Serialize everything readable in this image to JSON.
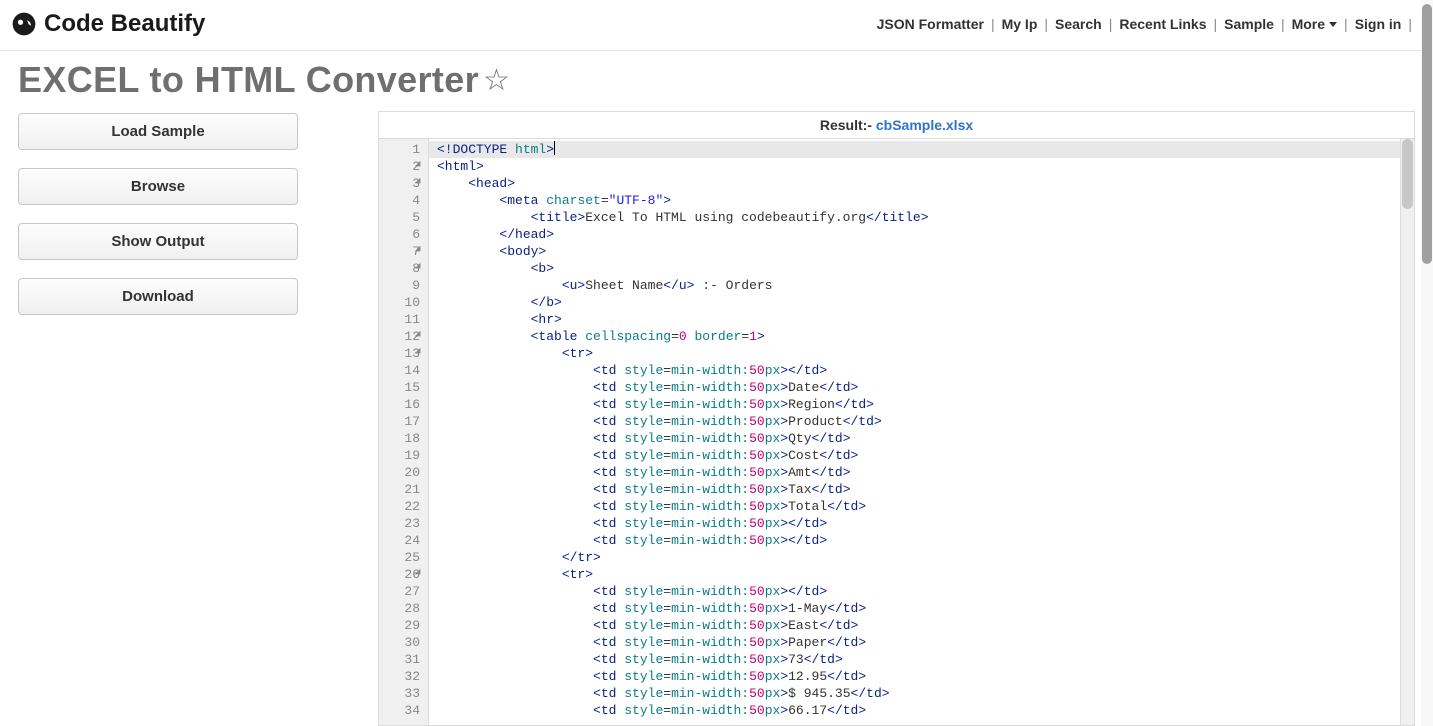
{
  "header": {
    "brand": "Code Beautify",
    "nav": [
      {
        "label": "JSON Formatter",
        "dropdown": false
      },
      {
        "label": "My Ip",
        "dropdown": false
      },
      {
        "label": "Search",
        "dropdown": false
      },
      {
        "label": "Recent Links",
        "dropdown": false
      },
      {
        "label": "Sample",
        "dropdown": false
      },
      {
        "label": "More",
        "dropdown": true
      },
      {
        "label": "Sign in",
        "dropdown": false
      }
    ]
  },
  "page": {
    "title": "EXCEL to HTML Converter"
  },
  "sidebar": {
    "buttons": [
      {
        "label": "Load Sample"
      },
      {
        "label": "Browse"
      },
      {
        "label": "Show Output"
      },
      {
        "label": "Download"
      }
    ]
  },
  "result": {
    "label": "Result:- ",
    "filename": "cbSample.xlsx"
  },
  "editor": {
    "highlighted_line": 1,
    "lines": [
      {
        "n": 1,
        "fold": false,
        "indent": 0,
        "tokens": [
          {
            "t": "tag",
            "v": "<!DOCTYPE "
          },
          {
            "t": "attr",
            "v": "html"
          },
          {
            "t": "tag",
            "v": ">"
          }
        ],
        "cursor": true
      },
      {
        "n": 2,
        "fold": true,
        "indent": 0,
        "tokens": [
          {
            "t": "tag",
            "v": "<html>"
          }
        ]
      },
      {
        "n": 3,
        "fold": true,
        "indent": 1,
        "tokens": [
          {
            "t": "tag",
            "v": "<head>"
          }
        ]
      },
      {
        "n": 4,
        "fold": false,
        "indent": 2,
        "tokens": [
          {
            "t": "tag",
            "v": "<meta "
          },
          {
            "t": "attr",
            "v": "charset"
          },
          {
            "t": "eq",
            "v": "="
          },
          {
            "t": "str",
            "v": "\"UTF-8\""
          },
          {
            "t": "tag",
            "v": ">"
          }
        ]
      },
      {
        "n": 5,
        "fold": false,
        "indent": 3,
        "tokens": [
          {
            "t": "tag",
            "v": "<title>"
          },
          {
            "t": "txt",
            "v": "Excel To HTML using codebeautify.org"
          },
          {
            "t": "tag",
            "v": "</title>"
          }
        ]
      },
      {
        "n": 6,
        "fold": false,
        "indent": 2,
        "tokens": [
          {
            "t": "tag",
            "v": "</head>"
          }
        ]
      },
      {
        "n": 7,
        "fold": true,
        "indent": 2,
        "tokens": [
          {
            "t": "tag",
            "v": "<body>"
          }
        ]
      },
      {
        "n": 8,
        "fold": true,
        "indent": 3,
        "tokens": [
          {
            "t": "tag",
            "v": "<b>"
          }
        ]
      },
      {
        "n": 9,
        "fold": false,
        "indent": 4,
        "tokens": [
          {
            "t": "tag",
            "v": "<u>"
          },
          {
            "t": "txt",
            "v": "Sheet Name"
          },
          {
            "t": "tag",
            "v": "</u>"
          },
          {
            "t": "txt",
            "v": " :- Orders"
          }
        ]
      },
      {
        "n": 10,
        "fold": false,
        "indent": 3,
        "tokens": [
          {
            "t": "tag",
            "v": "</b>"
          }
        ]
      },
      {
        "n": 11,
        "fold": false,
        "indent": 3,
        "tokens": [
          {
            "t": "tag",
            "v": "<hr>"
          }
        ]
      },
      {
        "n": 12,
        "fold": true,
        "indent": 3,
        "tokens": [
          {
            "t": "tag",
            "v": "<table "
          },
          {
            "t": "attr",
            "v": "cellspacing"
          },
          {
            "t": "eq",
            "v": "="
          },
          {
            "t": "num",
            "v": "0"
          },
          {
            "t": "txt",
            "v": " "
          },
          {
            "t": "attr",
            "v": "border"
          },
          {
            "t": "eq",
            "v": "="
          },
          {
            "t": "num",
            "v": "1"
          },
          {
            "t": "tag",
            "v": ">"
          }
        ]
      },
      {
        "n": 13,
        "fold": true,
        "indent": 4,
        "tokens": [
          {
            "t": "tag",
            "v": "<tr>"
          }
        ]
      },
      {
        "n": 14,
        "fold": false,
        "indent": 5,
        "tokens": [
          {
            "t": "tag",
            "v": "<td "
          },
          {
            "t": "attr",
            "v": "style"
          },
          {
            "t": "eq",
            "v": "="
          },
          {
            "t": "attr",
            "v": "min-width:"
          },
          {
            "t": "num",
            "v": "50"
          },
          {
            "t": "attr",
            "v": "px"
          },
          {
            "t": "tag",
            "v": ">"
          },
          {
            "t": "tag",
            "v": "</td>"
          }
        ]
      },
      {
        "n": 15,
        "fold": false,
        "indent": 5,
        "tokens": [
          {
            "t": "tag",
            "v": "<td "
          },
          {
            "t": "attr",
            "v": "style"
          },
          {
            "t": "eq",
            "v": "="
          },
          {
            "t": "attr",
            "v": "min-width:"
          },
          {
            "t": "num",
            "v": "50"
          },
          {
            "t": "attr",
            "v": "px"
          },
          {
            "t": "tag",
            "v": ">"
          },
          {
            "t": "txt",
            "v": "Date"
          },
          {
            "t": "tag",
            "v": "</td>"
          }
        ]
      },
      {
        "n": 16,
        "fold": false,
        "indent": 5,
        "tokens": [
          {
            "t": "tag",
            "v": "<td "
          },
          {
            "t": "attr",
            "v": "style"
          },
          {
            "t": "eq",
            "v": "="
          },
          {
            "t": "attr",
            "v": "min-width:"
          },
          {
            "t": "num",
            "v": "50"
          },
          {
            "t": "attr",
            "v": "px"
          },
          {
            "t": "tag",
            "v": ">"
          },
          {
            "t": "txt",
            "v": "Region"
          },
          {
            "t": "tag",
            "v": "</td>"
          }
        ]
      },
      {
        "n": 17,
        "fold": false,
        "indent": 5,
        "tokens": [
          {
            "t": "tag",
            "v": "<td "
          },
          {
            "t": "attr",
            "v": "style"
          },
          {
            "t": "eq",
            "v": "="
          },
          {
            "t": "attr",
            "v": "min-width:"
          },
          {
            "t": "num",
            "v": "50"
          },
          {
            "t": "attr",
            "v": "px"
          },
          {
            "t": "tag",
            "v": ">"
          },
          {
            "t": "txt",
            "v": "Product"
          },
          {
            "t": "tag",
            "v": "</td>"
          }
        ]
      },
      {
        "n": 18,
        "fold": false,
        "indent": 5,
        "tokens": [
          {
            "t": "tag",
            "v": "<td "
          },
          {
            "t": "attr",
            "v": "style"
          },
          {
            "t": "eq",
            "v": "="
          },
          {
            "t": "attr",
            "v": "min-width:"
          },
          {
            "t": "num",
            "v": "50"
          },
          {
            "t": "attr",
            "v": "px"
          },
          {
            "t": "tag",
            "v": ">"
          },
          {
            "t": "txt",
            "v": "Qty"
          },
          {
            "t": "tag",
            "v": "</td>"
          }
        ]
      },
      {
        "n": 19,
        "fold": false,
        "indent": 5,
        "tokens": [
          {
            "t": "tag",
            "v": "<td "
          },
          {
            "t": "attr",
            "v": "style"
          },
          {
            "t": "eq",
            "v": "="
          },
          {
            "t": "attr",
            "v": "min-width:"
          },
          {
            "t": "num",
            "v": "50"
          },
          {
            "t": "attr",
            "v": "px"
          },
          {
            "t": "tag",
            "v": ">"
          },
          {
            "t": "txt",
            "v": "Cost"
          },
          {
            "t": "tag",
            "v": "</td>"
          }
        ]
      },
      {
        "n": 20,
        "fold": false,
        "indent": 5,
        "tokens": [
          {
            "t": "tag",
            "v": "<td "
          },
          {
            "t": "attr",
            "v": "style"
          },
          {
            "t": "eq",
            "v": "="
          },
          {
            "t": "attr",
            "v": "min-width:"
          },
          {
            "t": "num",
            "v": "50"
          },
          {
            "t": "attr",
            "v": "px"
          },
          {
            "t": "tag",
            "v": ">"
          },
          {
            "t": "txt",
            "v": "Amt"
          },
          {
            "t": "tag",
            "v": "</td>"
          }
        ]
      },
      {
        "n": 21,
        "fold": false,
        "indent": 5,
        "tokens": [
          {
            "t": "tag",
            "v": "<td "
          },
          {
            "t": "attr",
            "v": "style"
          },
          {
            "t": "eq",
            "v": "="
          },
          {
            "t": "attr",
            "v": "min-width:"
          },
          {
            "t": "num",
            "v": "50"
          },
          {
            "t": "attr",
            "v": "px"
          },
          {
            "t": "tag",
            "v": ">"
          },
          {
            "t": "txt",
            "v": "Tax"
          },
          {
            "t": "tag",
            "v": "</td>"
          }
        ]
      },
      {
        "n": 22,
        "fold": false,
        "indent": 5,
        "tokens": [
          {
            "t": "tag",
            "v": "<td "
          },
          {
            "t": "attr",
            "v": "style"
          },
          {
            "t": "eq",
            "v": "="
          },
          {
            "t": "attr",
            "v": "min-width:"
          },
          {
            "t": "num",
            "v": "50"
          },
          {
            "t": "attr",
            "v": "px"
          },
          {
            "t": "tag",
            "v": ">"
          },
          {
            "t": "txt",
            "v": "Total"
          },
          {
            "t": "tag",
            "v": "</td>"
          }
        ]
      },
      {
        "n": 23,
        "fold": false,
        "indent": 5,
        "tokens": [
          {
            "t": "tag",
            "v": "<td "
          },
          {
            "t": "attr",
            "v": "style"
          },
          {
            "t": "eq",
            "v": "="
          },
          {
            "t": "attr",
            "v": "min-width:"
          },
          {
            "t": "num",
            "v": "50"
          },
          {
            "t": "attr",
            "v": "px"
          },
          {
            "t": "tag",
            "v": ">"
          },
          {
            "t": "tag",
            "v": "</td>"
          }
        ]
      },
      {
        "n": 24,
        "fold": false,
        "indent": 5,
        "tokens": [
          {
            "t": "tag",
            "v": "<td "
          },
          {
            "t": "attr",
            "v": "style"
          },
          {
            "t": "eq",
            "v": "="
          },
          {
            "t": "attr",
            "v": "min-width:"
          },
          {
            "t": "num",
            "v": "50"
          },
          {
            "t": "attr",
            "v": "px"
          },
          {
            "t": "tag",
            "v": ">"
          },
          {
            "t": "tag",
            "v": "</td>"
          }
        ]
      },
      {
        "n": 25,
        "fold": false,
        "indent": 4,
        "tokens": [
          {
            "t": "tag",
            "v": "</tr>"
          }
        ]
      },
      {
        "n": 26,
        "fold": true,
        "indent": 4,
        "tokens": [
          {
            "t": "tag",
            "v": "<tr>"
          }
        ]
      },
      {
        "n": 27,
        "fold": false,
        "indent": 5,
        "tokens": [
          {
            "t": "tag",
            "v": "<td "
          },
          {
            "t": "attr",
            "v": "style"
          },
          {
            "t": "eq",
            "v": "="
          },
          {
            "t": "attr",
            "v": "min-width:"
          },
          {
            "t": "num",
            "v": "50"
          },
          {
            "t": "attr",
            "v": "px"
          },
          {
            "t": "tag",
            "v": ">"
          },
          {
            "t": "tag",
            "v": "</td>"
          }
        ]
      },
      {
        "n": 28,
        "fold": false,
        "indent": 5,
        "tokens": [
          {
            "t": "tag",
            "v": "<td "
          },
          {
            "t": "attr",
            "v": "style"
          },
          {
            "t": "eq",
            "v": "="
          },
          {
            "t": "attr",
            "v": "min-width:"
          },
          {
            "t": "num",
            "v": "50"
          },
          {
            "t": "attr",
            "v": "px"
          },
          {
            "t": "tag",
            "v": ">"
          },
          {
            "t": "txt",
            "v": "1-May"
          },
          {
            "t": "tag",
            "v": "</td>"
          }
        ]
      },
      {
        "n": 29,
        "fold": false,
        "indent": 5,
        "tokens": [
          {
            "t": "tag",
            "v": "<td "
          },
          {
            "t": "attr",
            "v": "style"
          },
          {
            "t": "eq",
            "v": "="
          },
          {
            "t": "attr",
            "v": "min-width:"
          },
          {
            "t": "num",
            "v": "50"
          },
          {
            "t": "attr",
            "v": "px"
          },
          {
            "t": "tag",
            "v": ">"
          },
          {
            "t": "txt",
            "v": "East"
          },
          {
            "t": "tag",
            "v": "</td>"
          }
        ]
      },
      {
        "n": 30,
        "fold": false,
        "indent": 5,
        "tokens": [
          {
            "t": "tag",
            "v": "<td "
          },
          {
            "t": "attr",
            "v": "style"
          },
          {
            "t": "eq",
            "v": "="
          },
          {
            "t": "attr",
            "v": "min-width:"
          },
          {
            "t": "num",
            "v": "50"
          },
          {
            "t": "attr",
            "v": "px"
          },
          {
            "t": "tag",
            "v": ">"
          },
          {
            "t": "txt",
            "v": "Paper"
          },
          {
            "t": "tag",
            "v": "</td>"
          }
        ]
      },
      {
        "n": 31,
        "fold": false,
        "indent": 5,
        "tokens": [
          {
            "t": "tag",
            "v": "<td "
          },
          {
            "t": "attr",
            "v": "style"
          },
          {
            "t": "eq",
            "v": "="
          },
          {
            "t": "attr",
            "v": "min-width:"
          },
          {
            "t": "num",
            "v": "50"
          },
          {
            "t": "attr",
            "v": "px"
          },
          {
            "t": "tag",
            "v": ">"
          },
          {
            "t": "txt",
            "v": "73"
          },
          {
            "t": "tag",
            "v": "</td>"
          }
        ]
      },
      {
        "n": 32,
        "fold": false,
        "indent": 5,
        "tokens": [
          {
            "t": "tag",
            "v": "<td "
          },
          {
            "t": "attr",
            "v": "style"
          },
          {
            "t": "eq",
            "v": "="
          },
          {
            "t": "attr",
            "v": "min-width:"
          },
          {
            "t": "num",
            "v": "50"
          },
          {
            "t": "attr",
            "v": "px"
          },
          {
            "t": "tag",
            "v": ">"
          },
          {
            "t": "txt",
            "v": "12.95"
          },
          {
            "t": "tag",
            "v": "</td>"
          }
        ]
      },
      {
        "n": 33,
        "fold": false,
        "indent": 5,
        "tokens": [
          {
            "t": "tag",
            "v": "<td "
          },
          {
            "t": "attr",
            "v": "style"
          },
          {
            "t": "eq",
            "v": "="
          },
          {
            "t": "attr",
            "v": "min-width:"
          },
          {
            "t": "num",
            "v": "50"
          },
          {
            "t": "attr",
            "v": "px"
          },
          {
            "t": "tag",
            "v": ">"
          },
          {
            "t": "txt",
            "v": "$ 945.35"
          },
          {
            "t": "tag",
            "v": "</td>"
          }
        ]
      },
      {
        "n": 34,
        "fold": false,
        "indent": 5,
        "tokens": [
          {
            "t": "tag",
            "v": "<td "
          },
          {
            "t": "attr",
            "v": "style"
          },
          {
            "t": "eq",
            "v": "="
          },
          {
            "t": "attr",
            "v": "min-width:"
          },
          {
            "t": "num",
            "v": "50"
          },
          {
            "t": "attr",
            "v": "px"
          },
          {
            "t": "tag",
            "v": ">"
          },
          {
            "t": "txt",
            "v": "66.17"
          },
          {
            "t": "tag",
            "v": "</td>"
          }
        ]
      }
    ]
  }
}
